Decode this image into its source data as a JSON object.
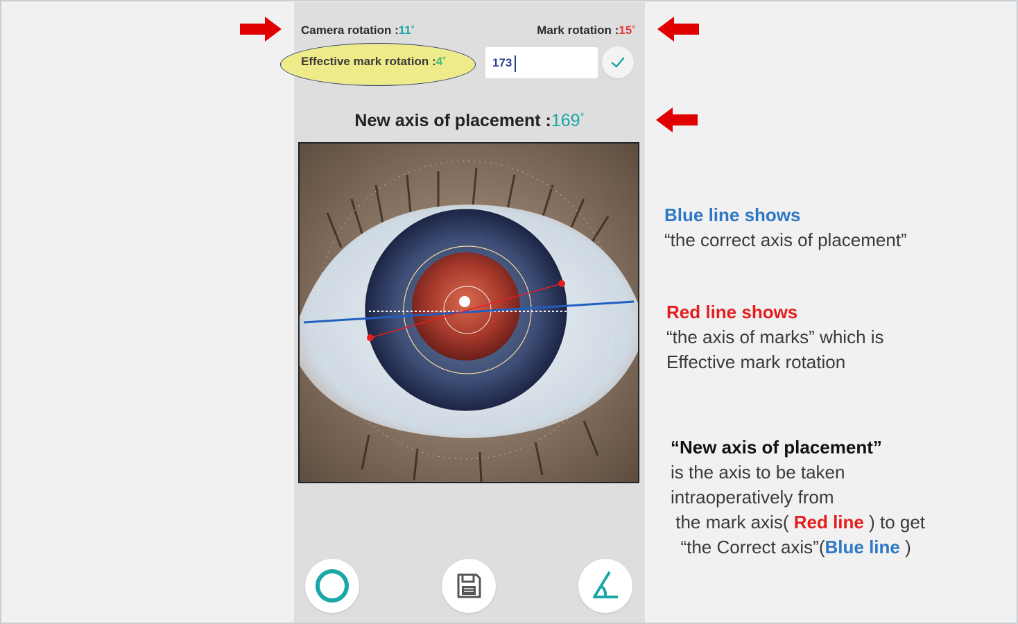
{
  "phone": {
    "camera_rotation_label": "Camera rotation :",
    "camera_rotation_value": "11",
    "mark_rotation_label": "Mark rotation :",
    "mark_rotation_value": "15",
    "effective_rotation_label": "Effective mark rotation :",
    "effective_rotation_value": "4",
    "degree_symbol": "°",
    "axis_input_value": "173",
    "new_axis_label": "New axis of placement :",
    "new_axis_value": "169"
  },
  "annotations": {
    "blue_title": "Blue line shows",
    "blue_desc": "“the correct axis of placement”",
    "red_title": "Red line shows",
    "red_desc_1": "“the axis of marks” which is",
    "red_desc_2": "Effective mark rotation",
    "new_title": "“New axis of placement”",
    "new_desc_1": "is the axis to be taken",
    "new_desc_2": "intraoperatively from",
    "new_desc_3a": "the mark axis( ",
    "new_desc_3_red": "Red line",
    "new_desc_3b": " ) to get",
    "new_desc_4a": "“the Correct axis”(",
    "new_desc_4_blue": "Blue line",
    "new_desc_4b": " )"
  },
  "icons": {
    "confirm": "check-icon",
    "circle": "circle-icon",
    "save": "save-icon",
    "angle": "angle-icon",
    "arrows": "red-arrow-icon"
  },
  "colors": {
    "teal": "#1aa7a8",
    "red": "#e23b3b",
    "blue_line": "#1f5fbf",
    "red_line": "#e41e1e",
    "highlight": "#eeeb8a"
  }
}
